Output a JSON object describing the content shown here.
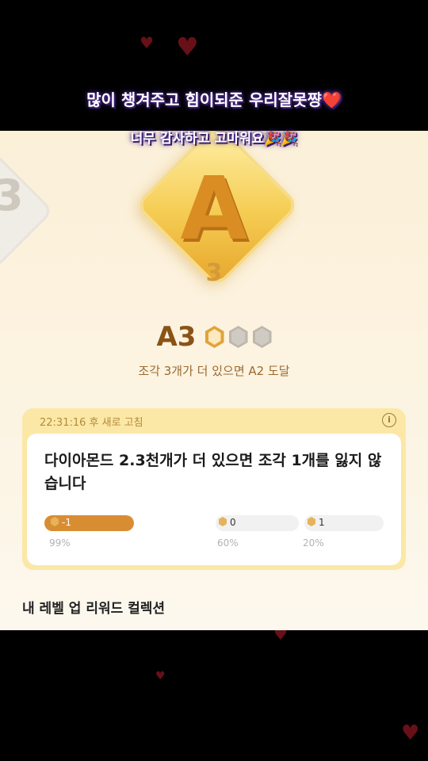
{
  "caption": {
    "line1": "많이 챙겨주고 힘이되준 우리잘못쨩",
    "line1_emoji": "❤️",
    "line2": "너무 감사하고 고마워요",
    "line2_emoji": "🎉🎉"
  },
  "rank": {
    "previous_letter": "3",
    "badge_letter": "A",
    "badge_number": "3",
    "label": "A3",
    "pieces_total": 3,
    "pieces_filled": 1,
    "subtitle": "조각 3개가 더 있으면 A2 도달"
  },
  "card": {
    "refresh_time": "22:31:16 후 새로 고침",
    "message": "다이아몬드 2.3천개가 더 있으면 조각 1개를 잃지 않습니다",
    "bars": [
      {
        "label": "-1",
        "percent": "99%",
        "active": true
      },
      {
        "label": "0",
        "percent": "60%",
        "active": false
      },
      {
        "label": "1",
        "percent": "20%",
        "active": false
      }
    ]
  },
  "collection_title": "내 레벨 업 리워드 컬렉션",
  "colors": {
    "accent": "#d98d32",
    "rank_text": "#8a5316",
    "card_bg": "#fbe8a6"
  }
}
